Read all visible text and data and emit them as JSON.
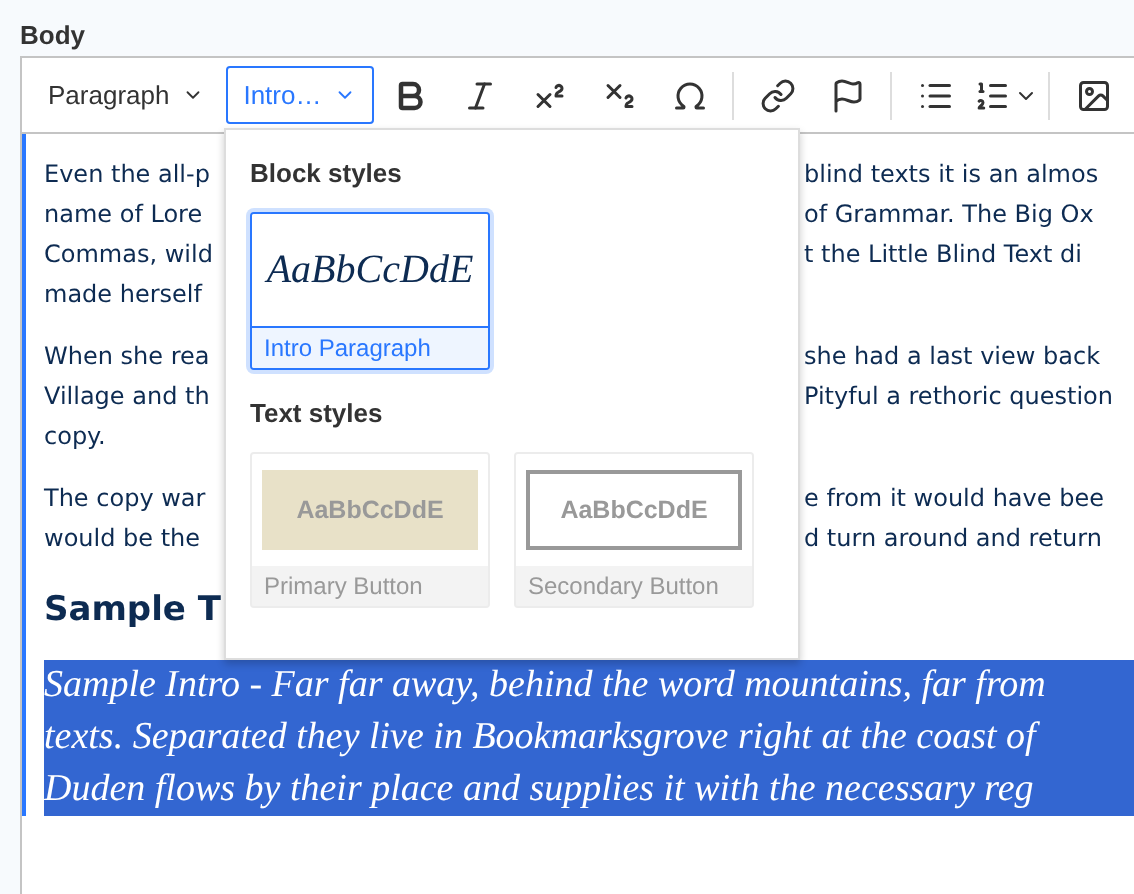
{
  "field_label": "Body",
  "toolbar": [
    {
      "kind": "dropdown",
      "label": "Paragraph",
      "open": false
    },
    {
      "kind": "dropdown",
      "label": "Intro…",
      "open": true
    },
    {
      "kind": "bold"
    },
    {
      "kind": "italic"
    },
    {
      "kind": "superscript"
    },
    {
      "kind": "subscript"
    },
    {
      "kind": "special-characters"
    },
    {
      "kind": "separator"
    },
    {
      "kind": "link"
    },
    {
      "kind": "flag"
    },
    {
      "kind": "separator"
    },
    {
      "kind": "bullet-list"
    },
    {
      "kind": "numbered-list"
    },
    {
      "kind": "separator"
    },
    {
      "kind": "image"
    }
  ],
  "content": [
    {
      "kind": "paragraph",
      "lines": [
        {
          "left": "Even the all-p",
          "right": "blind texts it is an almos"
        },
        {
          "left": "name of Lore",
          "right": "of Grammar. The Big Ox"
        },
        {
          "left": "Commas, wild",
          "right": "t the Little Blind Text di"
        },
        {
          "left": "made herself"
        }
      ]
    },
    {
      "kind": "paragraph",
      "lines": [
        {
          "left": "When she rea",
          "right": "she had a last view back"
        },
        {
          "left": "Village and th",
          "right": "Pityful a rethoric question"
        },
        {
          "left": "copy."
        }
      ]
    },
    {
      "kind": "paragraph",
      "lines": [
        {
          "left": "The copy war",
          "right": "e from it would have bee"
        },
        {
          "left": "would be the",
          "right": "d turn around and return"
        }
      ]
    },
    {
      "kind": "heading",
      "lines": [
        {
          "left": "Sample T"
        }
      ]
    },
    {
      "kind": "intro",
      "selected": true,
      "lines": [
        {
          "left": "Sample Intro - Far far away, behind the word mountains, far from"
        },
        {
          "left": "texts. Separated they live in Bookmarksgrove right at the coast of"
        },
        {
          "left": "Duden flows by their place and supplies it with the necessary reg"
        }
      ]
    }
  ],
  "style_menu": {
    "sections": [
      {
        "title": "Block styles",
        "items": [
          {
            "kind": "intro",
            "preview": "AaBbCcDdE",
            "label": "Intro Paragraph",
            "selected": true
          }
        ]
      },
      {
        "title": "Text styles",
        "items": [
          {
            "kind": "primary",
            "preview": "AaBbCcDdE",
            "label": "Primary Button",
            "selected": false
          },
          {
            "kind": "secondary",
            "preview": "AaBbCcDdE",
            "label": "Secondary Button",
            "selected": false
          }
        ]
      }
    ]
  }
}
